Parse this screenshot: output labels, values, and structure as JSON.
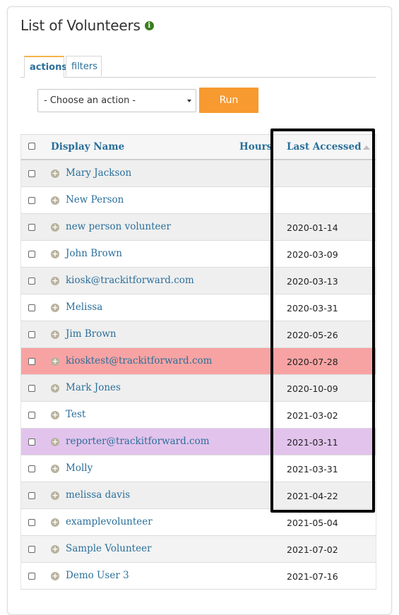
{
  "title": "List of Volunteers",
  "info_icon": "info-icon",
  "tabs": [
    {
      "label": "actions",
      "active": true
    },
    {
      "label": "filters",
      "active": false
    }
  ],
  "action_select": {
    "value": "- Choose an action -"
  },
  "run_button": {
    "label": "Run"
  },
  "table": {
    "headers": {
      "display_name": "Display Name",
      "hours": "Hours",
      "last_accessed": "Last Accessed"
    },
    "rows": [
      {
        "name": "Mary Jackson",
        "last_accessed": ""
      },
      {
        "name": "New Person",
        "last_accessed": ""
      },
      {
        "name": "new person volunteer",
        "last_accessed": "2020-01-14"
      },
      {
        "name": "John Brown",
        "last_accessed": "2020-03-09"
      },
      {
        "name": "kiosk@trackitforward.com",
        "last_accessed": "2020-03-13"
      },
      {
        "name": "Melissa",
        "last_accessed": "2020-03-31"
      },
      {
        "name": "Jim Brown",
        "last_accessed": "2020-05-26"
      },
      {
        "name": "kiosktest@trackitforward.com",
        "last_accessed": "2020-07-28"
      },
      {
        "name": "Mark Jones",
        "last_accessed": "2020-10-09"
      },
      {
        "name": "Test",
        "last_accessed": "2021-03-02"
      },
      {
        "name": "reporter@trackitforward.com",
        "last_accessed": "2021-03-11"
      },
      {
        "name": "Molly",
        "last_accessed": "2021-03-31"
      },
      {
        "name": "melissa davis",
        "last_accessed": "2021-04-22"
      },
      {
        "name": "examplevolunteer",
        "last_accessed": "2021-05-04"
      },
      {
        "name": "Sample Volunteer",
        "last_accessed": "2021-07-02"
      },
      {
        "name": "Demo User 3",
        "last_accessed": "2021-07-16"
      }
    ]
  },
  "colors": {
    "link": "#2a6f9a",
    "run_button": "#f79a30",
    "active_tab_accent": "#f7b34a",
    "row_highlight_red": "#f8a3a3",
    "row_highlight_purple": "#e2c3ec",
    "annotation_box": "#000000"
  }
}
